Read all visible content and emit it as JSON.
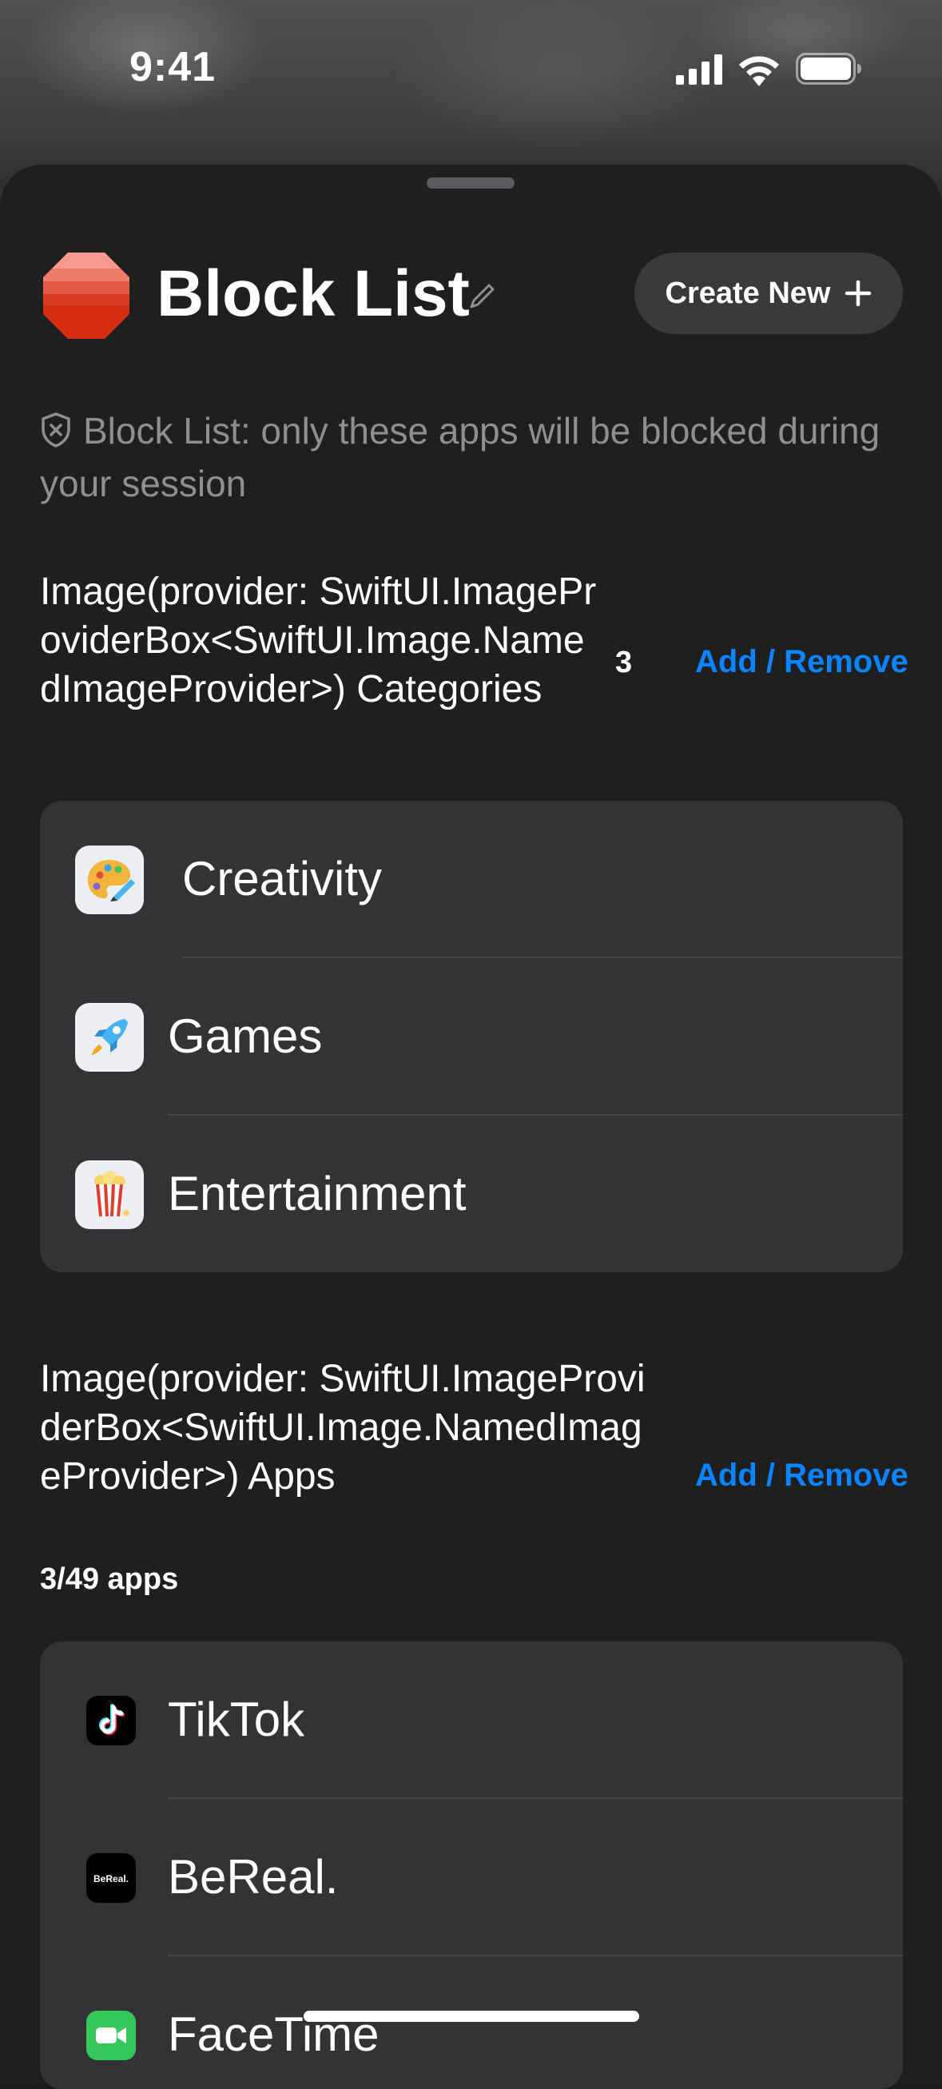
{
  "status_bar": {
    "time": "9:41"
  },
  "header": {
    "title": "Block List",
    "create_button": "Create New"
  },
  "info_text": "Block List: only these apps will be blocked during your session",
  "categories_section": {
    "title": "Image(provider: SwiftUI.ImageProviderBox<SwiftUI.Image.NamedImageProvider>) Categories",
    "count": "3",
    "action": "Add / Remove",
    "items": [
      {
        "label": "Creativity",
        "icon": "palette-icon"
      },
      {
        "label": "Games",
        "icon": "rocket-icon"
      },
      {
        "label": "Entertainment",
        "icon": "popcorn-icon"
      }
    ]
  },
  "apps_section": {
    "title": "Image(provider: SwiftUI.ImageProviderBox<SwiftUI.Image.NamedImageProvider>) Apps",
    "action": "Add / Remove",
    "subtitle": "3/49 apps",
    "items": [
      {
        "label": "TikTok",
        "icon": "tiktok-icon"
      },
      {
        "label": "BeReal.",
        "icon": "bereal-icon",
        "icon_text": "BeReal."
      },
      {
        "label": "FaceTime",
        "icon": "facetime-icon"
      }
    ]
  },
  "colors": {
    "accent": "#0A84FF",
    "sheet": "#1F1F20",
    "card": "#333336",
    "secondary_text": "#8E8E93"
  }
}
